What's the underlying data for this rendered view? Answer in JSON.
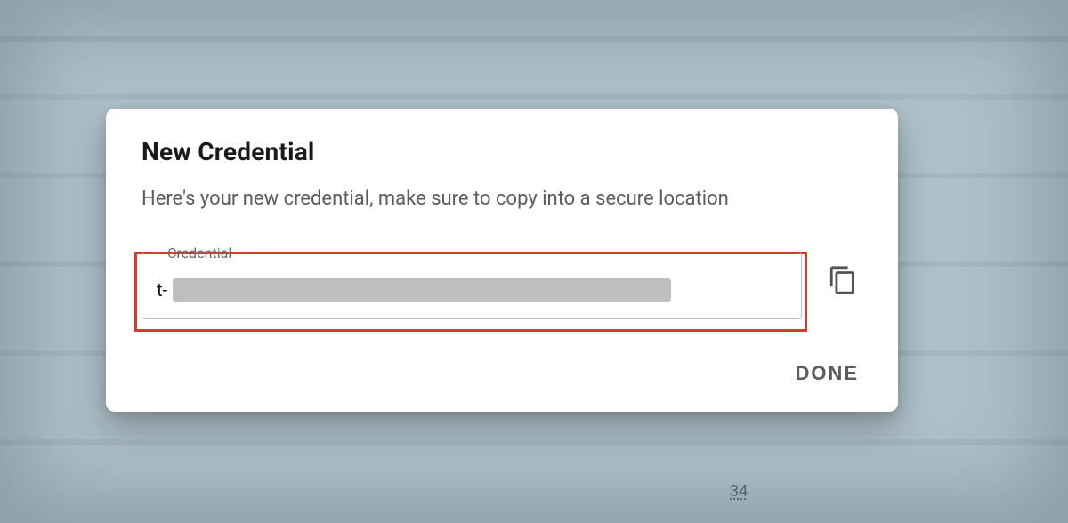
{
  "dialog": {
    "title": "New Credential",
    "description": "Here's your new credential, make sure to copy into a secure location",
    "field_label": "Credential",
    "credential_prefix": "t-",
    "done_label": "DONE"
  },
  "background": {
    "visible_number": "34"
  }
}
